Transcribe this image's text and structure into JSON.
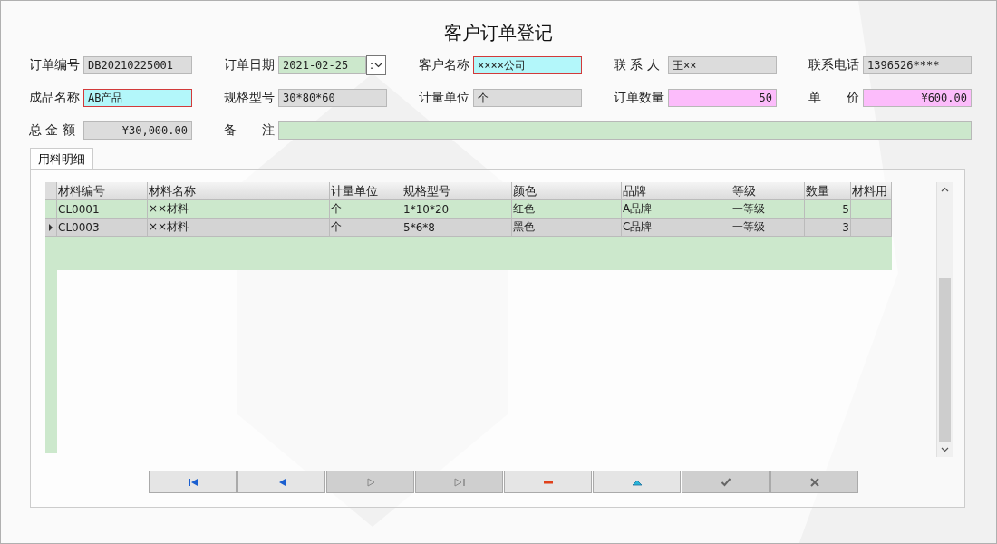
{
  "window": {
    "title": "客户订单登记"
  },
  "fields": [
    {
      "label": "订单编号",
      "value": "DB20210225001",
      "kind": "text"
    },
    {
      "label": "订单日期",
      "value": "2021-02-25",
      "kind": "date",
      "dropdown": ":"
    },
    {
      "label": "客户名称",
      "value": "××××公司",
      "kind": "required"
    },
    {
      "label": "联 系 人",
      "value": "王××",
      "kind": "text"
    },
    {
      "label": "联系电话",
      "value": "1396526****",
      "kind": "text"
    },
    {
      "label": "成品名称",
      "value": "AB产品",
      "kind": "required"
    },
    {
      "label": "规格型号",
      "value": "30*80*60",
      "kind": "text"
    },
    {
      "label": "计量单位",
      "value": "个",
      "kind": "text"
    },
    {
      "label": "订单数量",
      "value": "50",
      "kind": "entry"
    },
    {
      "label": "单　　价",
      "value": "¥600.00",
      "kind": "entry"
    },
    {
      "label": "总 金 额",
      "value": "¥30,000.00",
      "kind": "total"
    },
    {
      "label": "备　　注",
      "kind": "note"
    }
  ],
  "tabs": [
    {
      "label": "用料明细",
      "selected": true
    }
  ],
  "grid": {
    "columns": [
      "材料编号",
      "材料名称",
      "计量单位",
      "规格型号",
      "颜色",
      "品牌",
      "等级",
      "数量",
      "材料用"
    ],
    "rows": [
      {
        "selected": false,
        "cells": [
          "CL0001",
          "××材料",
          "个",
          "1*10*20",
          "红色",
          "A品牌",
          "一等级",
          "5",
          null
        ]
      },
      {
        "selected": true,
        "cells": [
          "CL0003",
          "××材料",
          "个",
          "5*6*8",
          "黑色",
          "C品牌",
          "一等级",
          "3",
          null
        ]
      }
    ]
  },
  "navigator": [
    {
      "kind": "first",
      "disabled": false
    },
    {
      "kind": "prev",
      "disabled": false
    },
    {
      "kind": "next",
      "disabled": true
    },
    {
      "kind": "last",
      "disabled": true
    },
    {
      "kind": "delete",
      "disabled": false
    },
    {
      "kind": "insert",
      "disabled": false
    },
    {
      "kind": "post",
      "disabled": true
    },
    {
      "kind": "cancel",
      "disabled": true
    }
  ]
}
